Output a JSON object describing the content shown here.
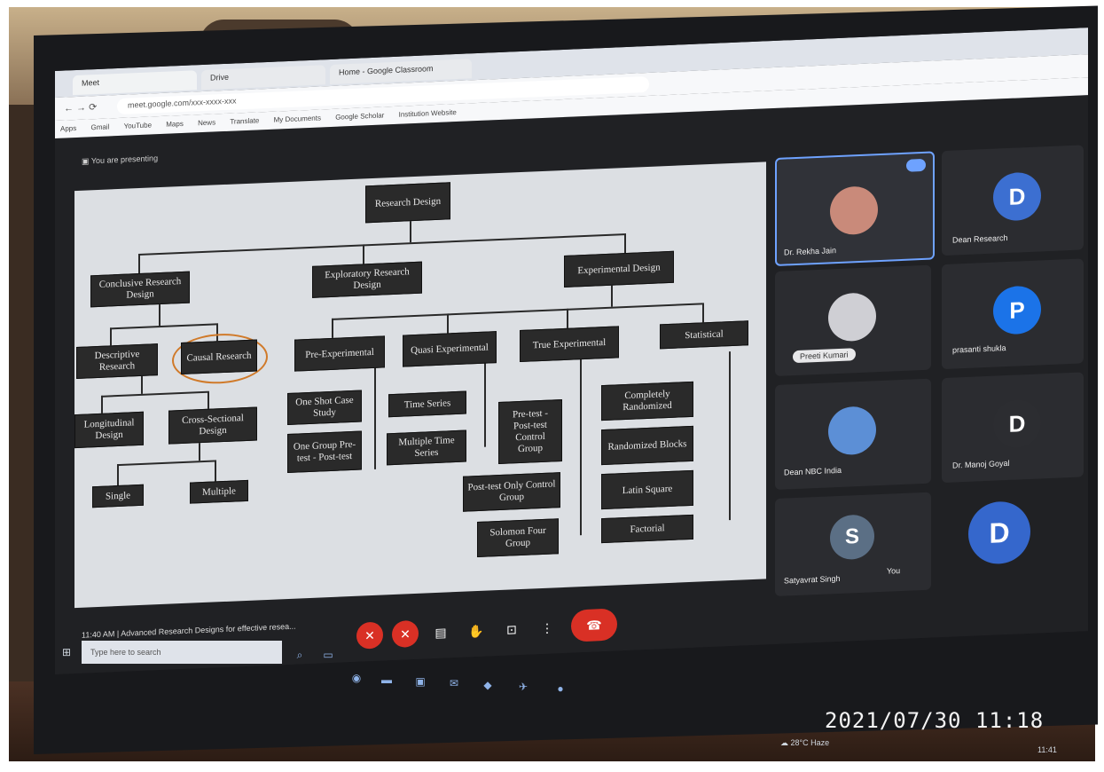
{
  "browser": {
    "tabs": [
      "Meet",
      "Drive",
      "Home - Google Classroom"
    ],
    "url": "meet.google.com/xxx-xxxx-xxx",
    "bookmarks": [
      "Apps",
      "Gmail",
      "YouTube",
      "Maps",
      "News",
      "Translate",
      "My Documents",
      "Google Scholar",
      "Institution Website"
    ]
  },
  "meet": {
    "presenting_text": "You are presenting",
    "meeting_title": "Advanced Research Designs for effective resea...",
    "meeting_code": "11:40 AM"
  },
  "slide": {
    "root": "Research Design",
    "level1": [
      "Conclusive Research Design",
      "Exploratory Research Design",
      "Experimental Design"
    ],
    "conclusive_children": [
      "Descriptive Research",
      "Causal Research"
    ],
    "descriptive_children": [
      "Longitudinal Design",
      "Cross-Sectional Design"
    ],
    "cross_sectional_children": [
      "Single",
      "Multiple"
    ],
    "experimental_children": [
      "Pre-Experimental",
      "Quasi Experimental",
      "True Experimental",
      "Statistical"
    ],
    "pre_experimental": [
      "One Shot Case Study",
      "One Group Pre-test - Post-test"
    ],
    "quasi_experimental": [
      "Time Series",
      "Multiple Time Series"
    ],
    "true_experimental": [
      "Pre-test - Post-test Control Group",
      "Post-test Only Control Group",
      "Solomon Four Group"
    ],
    "statistical": [
      "Completely Randomized",
      "Randomized Blocks",
      "Latin Square",
      "Factorial"
    ]
  },
  "participants": [
    {
      "name": "Dr. Rekha Jain",
      "initial": "",
      "color": "#c98a7a",
      "active": true
    },
    {
      "name": "Dean Research",
      "initial": "D",
      "color": "#3c6fd1"
    },
    {
      "name": "Preeti Kumari",
      "initial": "",
      "color": "#cfcfd4"
    },
    {
      "name": "prasanti shukla",
      "initial": "P",
      "color": "#1b73e8"
    },
    {
      "name": "Dean NBC India",
      "initial": "",
      "color": "#5c8fd6"
    },
    {
      "name": "Dr. Manoj Goyal",
      "initial": "D",
      "color": "#2c2d31"
    },
    {
      "name": "Satyavrat Singh",
      "initial": "S",
      "color": "#5b6f85"
    },
    {
      "name": "You",
      "initial": "D",
      "color": "#3567cc"
    }
  ],
  "taskbar": {
    "search_placeholder": "Type here to search",
    "tray_weather": "28°C Haze",
    "tray_time": "11:41"
  },
  "camera_timestamp": "2021/07/30  11:18",
  "colors": {
    "end_call": "#d93025",
    "highlight_circle": "#d07a2a"
  }
}
